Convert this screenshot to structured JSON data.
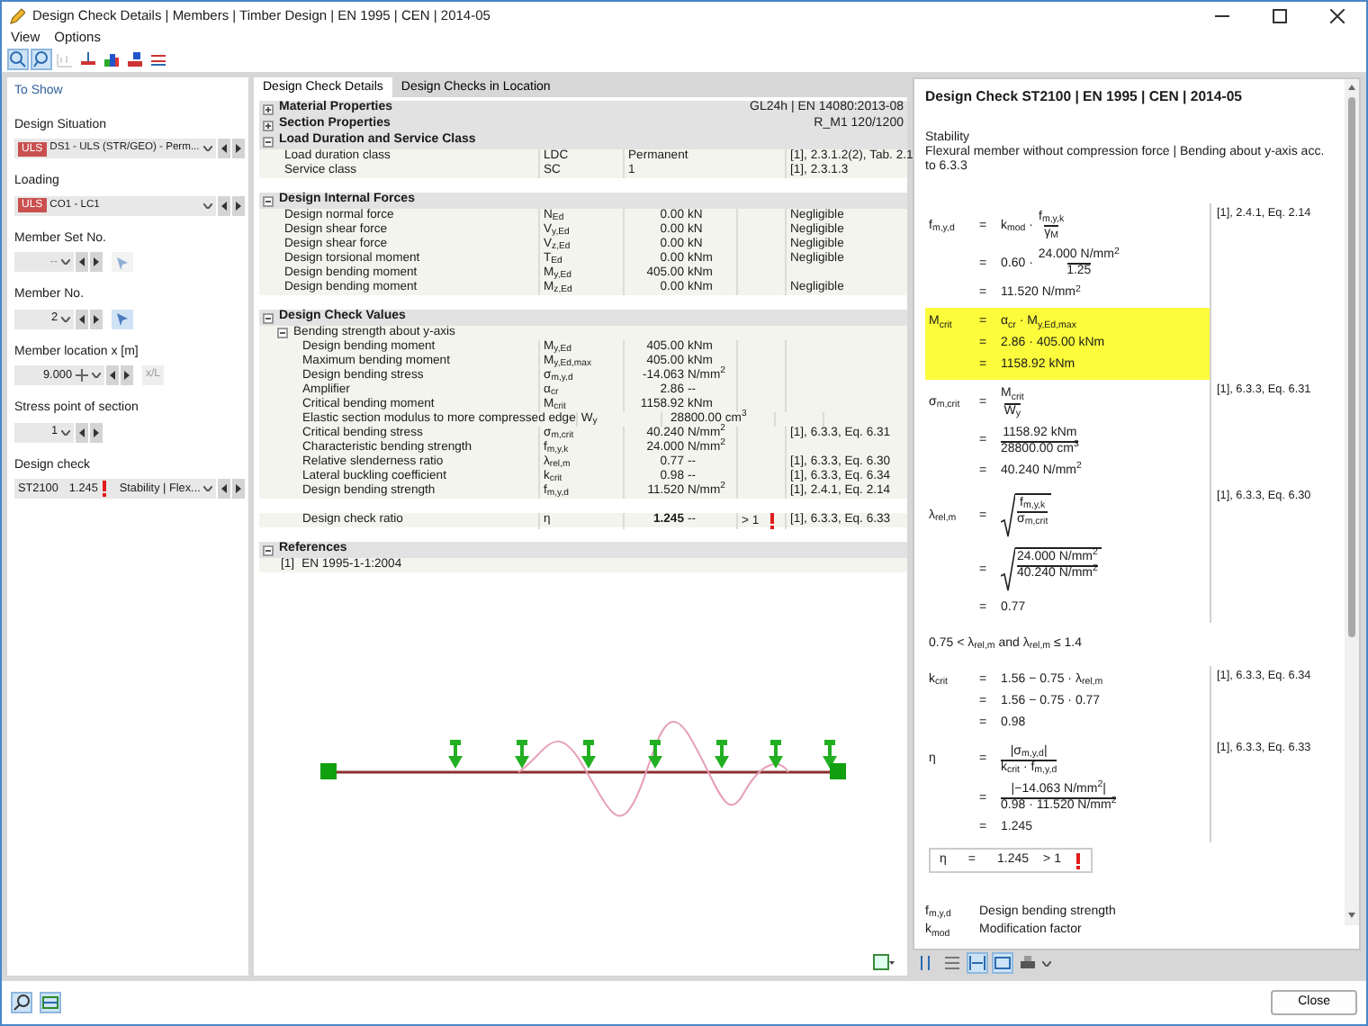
{
  "window": {
    "title": "Design Check Details | Members | Timber Design | EN 1995 | CEN | 2014-05"
  },
  "menu": [
    "View",
    "Options"
  ],
  "toolbar": [
    {
      "pressed": true,
      "disabled": false
    },
    {
      "pressed": true,
      "disabled": false
    },
    {
      "pressed": false,
      "disabled": true
    },
    {
      "pressed": false,
      "disabled": false
    },
    {
      "pressed": false,
      "disabled": false
    },
    {
      "pressed": false,
      "disabled": false
    },
    {
      "pressed": false,
      "disabled": false
    }
  ],
  "filters": {
    "heading": "To Show",
    "items": [
      {
        "label": "Design Situation",
        "kind": "combo",
        "badge": "ULS",
        "value": "DS1 - ULS (STR/GEO) - Perm..."
      },
      {
        "label": "Loading",
        "kind": "combo",
        "badge": "ULS",
        "value": "CO1 - LC1"
      },
      {
        "label": "Member Set No.",
        "kind": "number",
        "value": "--",
        "disabled": true
      },
      {
        "label": "Member No.",
        "kind": "number",
        "value": "2",
        "disabled": false
      },
      {
        "label": "Member location x [m]",
        "kind": "location",
        "value": "9.000",
        "toggle_label": "x/L"
      },
      {
        "label": "Stress point of section",
        "kind": "short",
        "value": "1"
      },
      {
        "label": "Design check",
        "kind": "check",
        "check_id": "ST2100",
        "ratio": "1.245",
        "warning": true,
        "value": "Stability | Flex..."
      }
    ]
  },
  "tabs": [
    {
      "label": "Design Check Details",
      "selected": true
    },
    {
      "label": "Design Checks in Location",
      "selected": false
    }
  ],
  "sections": [
    {
      "title": "Material Properties",
      "value": "GL24h | EN 14080:2013-08",
      "expanded": false
    },
    {
      "title": "Section Properties",
      "value": "R_M1 120/1200",
      "expanded": false
    },
    {
      "title": "Load Duration and Service Class",
      "expanded": true,
      "rows": [
        {
          "kind": "text",
          "description": "Load duration class",
          "symbol": "LDC",
          "value": "Permanent",
          "ref": "[1], 2.3.1.2(2), Tab. 2.1"
        },
        {
          "kind": "text",
          "description": "Service class",
          "symbol": "SC",
          "value": "1",
          "ref": "[1], 2.3.1.3"
        }
      ]
    },
    {
      "title": "Design Internal Forces",
      "expanded": true,
      "rows": [
        {
          "kind": "item",
          "description": "Design normal force",
          "symbol": "N$_{Ed}$",
          "value": "0.00",
          "unit": "kN",
          "note": "Negligible"
        },
        {
          "kind": "item",
          "description": "Design shear force",
          "symbol": "V$_{y,Ed}$",
          "value": "0.00",
          "unit": "kN",
          "note": "Negligible"
        },
        {
          "kind": "item",
          "description": "Design shear force",
          "symbol": "V$_{z,Ed}$",
          "value": "0.00",
          "unit": "kN",
          "note": "Negligible"
        },
        {
          "kind": "item",
          "description": "Design torsional moment",
          "symbol": "T$_{Ed}$",
          "value": "0.00",
          "unit": "kNm",
          "note": "Negligible"
        },
        {
          "kind": "item",
          "description": "Design bending moment",
          "symbol": "M$_{y,Ed}$",
          "value": "405.00",
          "unit": "kNm"
        },
        {
          "kind": "item",
          "description": "Design bending moment",
          "symbol": "M$_{z,Ed}$",
          "value": "0.00",
          "unit": "kNm",
          "note": "Negligible"
        }
      ]
    },
    {
      "title": "Design Check Values",
      "expanded": true,
      "rows": [
        {
          "kind": "group",
          "description": "Bending strength about y-axis",
          "expanded": true,
          "children": [
            {
              "kind": "item",
              "description": "Design bending moment",
              "symbol": "M$_{y,Ed}$",
              "value": "405.00",
              "unit": "kNm"
            },
            {
              "kind": "item",
              "description": "Maximum bending moment",
              "symbol": "M$_{y,Ed,max}$",
              "value": "405.00",
              "unit": "kNm"
            },
            {
              "kind": "item",
              "description": "Design bending stress",
              "symbol": "σ$_{m,y,d}$",
              "value": "-14.063",
              "unit": "N/mm$^{2}$"
            },
            {
              "kind": "item",
              "description": "Amplifier",
              "symbol": "α$_{cr}$",
              "value": "2.86",
              "unit": "--"
            },
            {
              "kind": "item",
              "description": "Critical bending moment",
              "symbol": "M$_{crit}$",
              "value": "1158.92",
              "unit": "kNm"
            },
            {
              "kind": "item",
              "description": "Elastic section modulus to more compressed edge",
              "symbol": "W$_{y}$",
              "value": "28800.00",
              "unit": "cm$^{3}$"
            },
            {
              "kind": "item",
              "description": "Critical bending stress",
              "symbol": "σ$_{m,crit}$",
              "value": "40.240",
              "unit": "N/mm$^{2}$",
              "ref": "[1], 6.3.3, Eq. 6.31"
            },
            {
              "kind": "item",
              "description": "Characteristic bending strength",
              "symbol": "f$_{m,y,k}$",
              "value": "24.000",
              "unit": "N/mm$^{2}$"
            },
            {
              "kind": "item",
              "description": "Relative slenderness ratio",
              "symbol": "λ$_{rel,m}$",
              "value": "0.77",
              "unit": "--",
              "ref": "[1], 6.3.3, Eq. 6.30"
            },
            {
              "kind": "item",
              "description": "Lateral buckling coefficient",
              "symbol": "k$_{crit}$",
              "value": "0.98",
              "unit": "--",
              "ref": "[1], 6.3.3, Eq. 6.34"
            },
            {
              "kind": "item",
              "description": "Design bending strength",
              "symbol": "f$_{m,y,d}$",
              "value": "11.520",
              "unit": "N/mm$^{2}$",
              "ref": "[1], 2.4.1, Eq. 2.14"
            },
            {
              "kind": "ratio",
              "description": "Design check ratio",
              "symbol": "η",
              "value": "1.245",
              "unit": "--",
              "limit": "> 1",
              "warning": true,
              "ref": "[1], 6.3.3, Eq. 6.33"
            }
          ]
        }
      ]
    },
    {
      "title": "References",
      "expanded": true,
      "rows": [
        {
          "kind": "reference",
          "tag": "[1]",
          "description": "EN 1995-1-1:2004"
        }
      ]
    }
  ],
  "details": {
    "title": "Design Check ST2100 | EN 1995 | CEN | 2014-05",
    "category": "Stability",
    "description": "Flexural member without compression force | Bending about y-axis acc. to 6.3.3",
    "blocks": [
      {
        "kind": "equation",
        "lhs": "f$_{m,y,d}$",
        "ref": "[1], 2.4.1, Eq. 2.14",
        "highlighted": false,
        "lines": [
          [
            "=",
            "k$_{mod}$ ·",
            {
              "kind": "frac",
              "num": "f$_{m,y,k}$",
              "den": "γ$_{M}$"
            }
          ],
          [
            "=",
            "0.60 ·",
            {
              "kind": "frac",
              "num": "24.000 N/mm$^{2}$",
              "den": "1.25"
            }
          ],
          [
            "=",
            "11.520 N/mm$^{2}$"
          ]
        ]
      },
      {
        "kind": "equation",
        "lhs": "M$_{crit}$",
        "highlighted": true,
        "lines": [
          [
            "=",
            "α$_{cr}$ · M$_{y,Ed,max}$"
          ],
          [
            "=",
            "2.86 · 405.00 kNm"
          ],
          [
            "=",
            "1158.92 kNm"
          ]
        ]
      },
      {
        "kind": "equation",
        "lhs": "σ$_{m,crit}$",
        "ref": "[1], 6.3.3, Eq. 6.31",
        "highlighted": false,
        "lines": [
          [
            "=",
            {
              "kind": "frac",
              "num": "M$_{crit}$",
              "den": "W$_{y}$"
            }
          ],
          [
            "=",
            {
              "kind": "frac",
              "num": "1158.92 kNm",
              "den": "28800.00 cm$^{3}$"
            }
          ],
          [
            "=",
            "40.240 N/mm$^{2}$"
          ]
        ]
      },
      {
        "kind": "equation",
        "lhs": "λ$_{rel,m}$",
        "ref": "[1], 6.3.3, Eq. 6.30",
        "highlighted": false,
        "lines": [
          [
            "=",
            {
              "kind": "sqrt",
              "num": "f$_{m,y,k}$",
              "den": "σ$_{m,crit}$"
            }
          ],
          [
            "=",
            {
              "kind": "sqrt",
              "num": "24.000 N/mm$^{2}$",
              "den": "40.240 N/mm$^{2}$"
            }
          ],
          [
            "=",
            "0.77"
          ]
        ]
      },
      {
        "kind": "condition",
        "text": "0.75 < λ$_{rel,m}$ and λ$_{rel,m}$ ≤ 1.4"
      },
      {
        "kind": "equation",
        "lhs": "k$_{crit}$",
        "ref": "[1], 6.3.3, Eq. 6.34",
        "highlighted": false,
        "lines": [
          [
            "=",
            "1.56 − 0.75 · λ$_{rel,m}$"
          ],
          [
            "=",
            "1.56 − 0.75 · 0.77"
          ],
          [
            "=",
            "0.98"
          ]
        ]
      },
      {
        "kind": "equation",
        "lhs": "η",
        "ref": "[1], 6.3.3, Eq. 6.33",
        "highlighted": false,
        "lines": [
          [
            "=",
            {
              "kind": "frac",
              "num": "|σ$_{m,y,d}$|",
              "den": "k$_{crit}$ · f$_{m,y,d}$"
            }
          ],
          [
            "=",
            {
              "kind": "frac",
              "num": "|−14.063 N/mm$^{2}$|",
              "den": "0.98 · 11.520 N/mm$^{2}$"
            }
          ],
          [
            "=",
            "1.245"
          ]
        ]
      },
      {
        "kind": "result",
        "lhs": "η",
        "rel": "=",
        "value": "1.245",
        "limit": "> 1",
        "warning": true
      }
    ],
    "legend": [
      {
        "symbol": "f$_{m,y,d}$",
        "text": "Design bending strength"
      },
      {
        "symbol": "k$_{mod}$",
        "text": "Modification factor"
      }
    ]
  },
  "right_toolbar": [
    {
      "pressed": false
    },
    {
      "pressed": false
    },
    {
      "pressed": true
    },
    {
      "pressed": true
    },
    {
      "pressed": false
    }
  ],
  "footer": {
    "close": "Close"
  }
}
